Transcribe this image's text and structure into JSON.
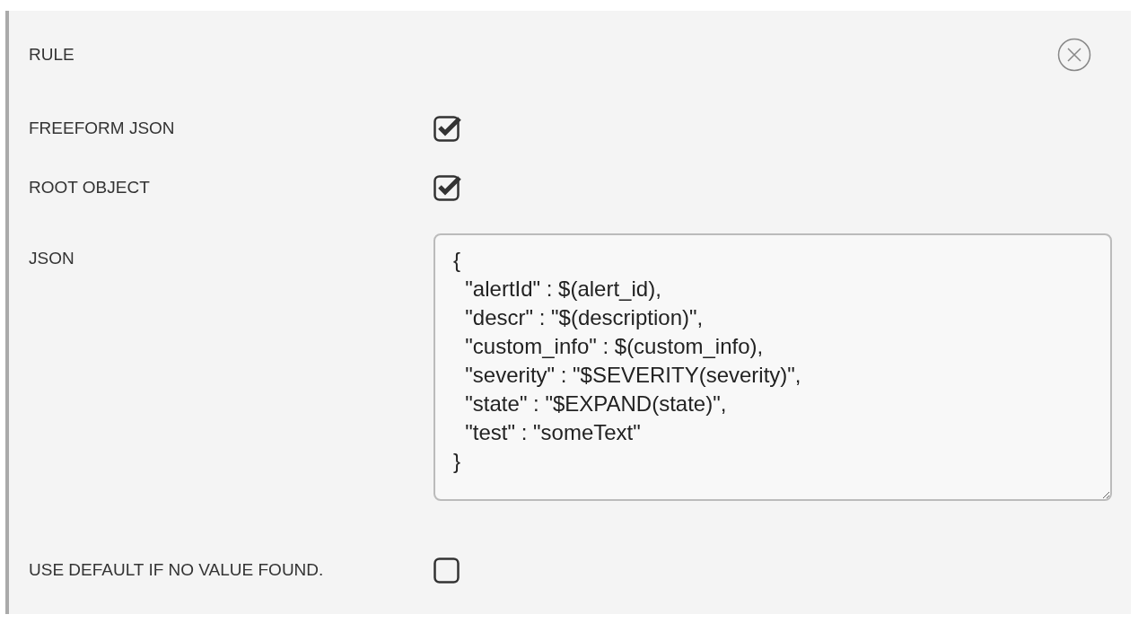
{
  "panel": {
    "title": "RULE",
    "fields": [
      {
        "label": "FREEFORM JSON",
        "kind": "checkbox",
        "checked": true
      },
      {
        "label": "ROOT OBJECT",
        "kind": "checkbox",
        "checked": true
      },
      {
        "label": "JSON",
        "kind": "textarea",
        "value": "{\n  \"alertId\" : $(alert_id),\n  \"descr\" : \"$(description)\",\n  \"custom_info\" : $(custom_info),\n  \"severity\" : \"$SEVERITY(severity)\",\n  \"state\" : \"$EXPAND(state)\",\n  \"test\" : \"someText\"\n}"
      },
      {
        "label": "USE DEFAULT IF NO VALUE FOUND.",
        "kind": "checkbox",
        "checked": false
      }
    ]
  }
}
